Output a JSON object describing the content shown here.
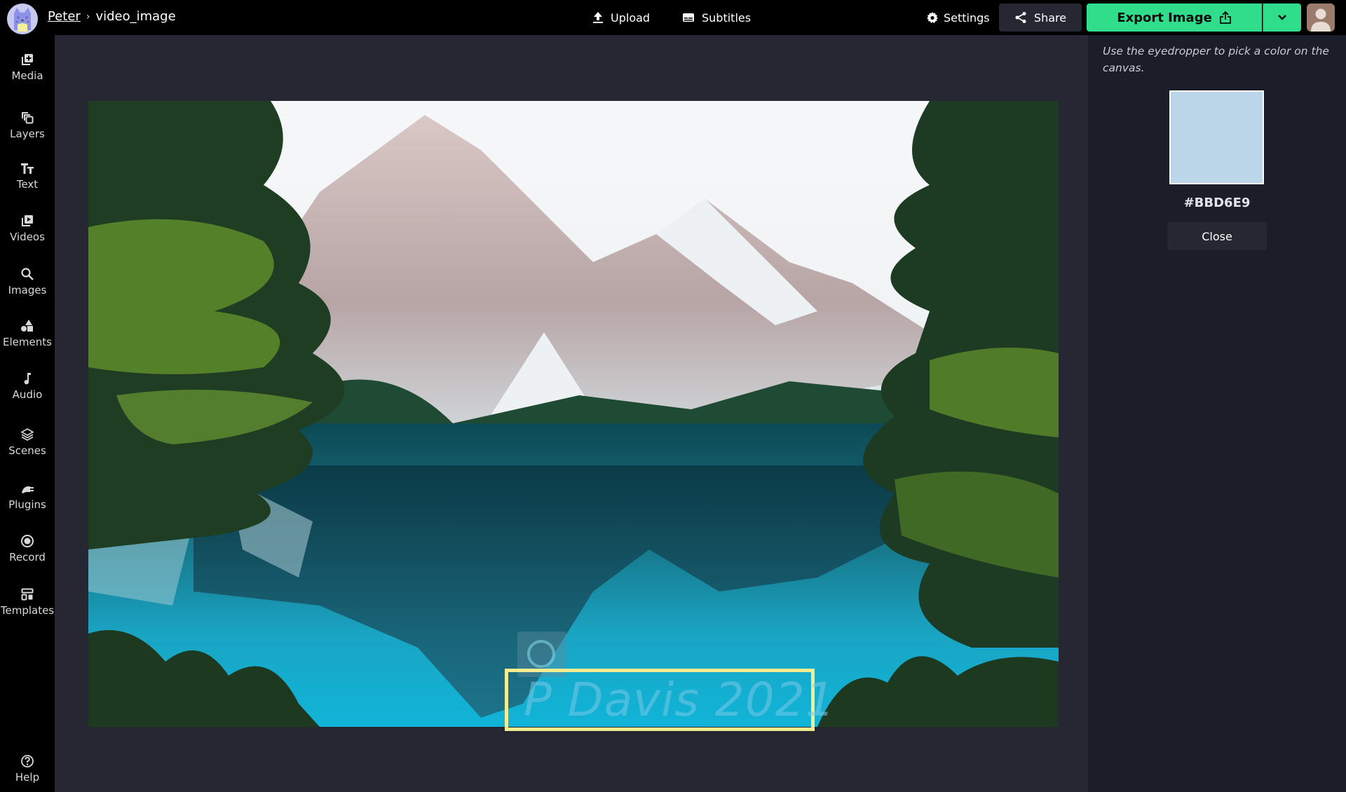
{
  "header": {
    "breadcrumb": {
      "user": "Peter",
      "separator": "›",
      "project": "video_image"
    },
    "upload_label": "Upload",
    "subtitles_label": "Subtitles",
    "settings_label": "Settings",
    "share_label": "Share",
    "export_label": "Export Image"
  },
  "sidebar": {
    "items": [
      {
        "label": "Media",
        "icon": "media-add-icon"
      },
      {
        "label": "Layers",
        "icon": "layers-icon"
      },
      {
        "label": "Text",
        "icon": "text-icon"
      },
      {
        "label": "Videos",
        "icon": "video-icon"
      },
      {
        "label": "Images",
        "icon": "search-icon"
      },
      {
        "label": "Elements",
        "icon": "shapes-icon"
      },
      {
        "label": "Audio",
        "icon": "music-note-icon"
      },
      {
        "label": "Scenes",
        "icon": "stack-icon"
      },
      {
        "label": "Plugins",
        "icon": "plug-icon"
      },
      {
        "label": "Record",
        "icon": "record-icon"
      },
      {
        "label": "Templates",
        "icon": "templates-icon"
      }
    ],
    "help_label": "Help"
  },
  "canvas": {
    "watermark_text": "P Davis 2021",
    "watermark_symbol": "©"
  },
  "panel": {
    "hint": "Use the eyedropper to pick a color on the canvas.",
    "picked_color": "#BBD6E9",
    "hex_label": "#BBD6E9",
    "close_label": "Close"
  },
  "colors": {
    "accent_green": "#2FDD8A",
    "selection_yellow": "#F4EC8E",
    "canvas_bg": "#262733",
    "panel_bg": "#1B1E28"
  }
}
